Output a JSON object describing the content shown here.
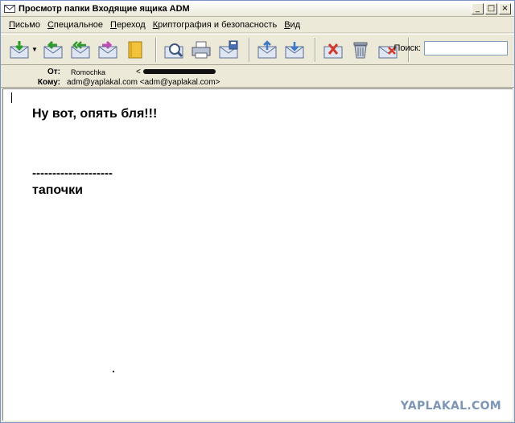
{
  "window": {
    "title": "Просмотр папки Входящие ящика ADM",
    "controls": [
      "_",
      "□",
      "×"
    ]
  },
  "menu": {
    "items": [
      {
        "first": "П",
        "rest": "исьмо"
      },
      {
        "first": "С",
        "rest": "пециальное"
      },
      {
        "first": "П",
        "rest": "ереход"
      },
      {
        "first": "К",
        "rest": "риптография и безопасность"
      },
      {
        "first": "В",
        "rest": "ид"
      }
    ]
  },
  "toolbar": {
    "search_label": "Поиск:",
    "search_value": ""
  },
  "headers": {
    "from_label": "От:",
    "from_name": "Romochka",
    "from_email_prefix": "<",
    "to_label": "Кому:",
    "to_value": "adm@yaplakal.com <adm@yaplakal.com>"
  },
  "message": {
    "line1": "Ну вот, опять бля!!!",
    "line2": "--------------------",
    "line3": "тапочки"
  },
  "watermark": "YAPLAKAL.COM",
  "colors": {
    "window_bg": "#ece9d8",
    "watermark": "#7e96b6"
  }
}
